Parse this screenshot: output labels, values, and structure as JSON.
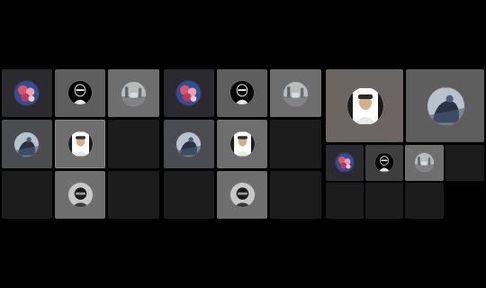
{
  "app": {
    "screen": "avatar-gallery"
  },
  "avatars": {
    "flowers": {
      "icon": "flower-bouquet-photo",
      "colors": [
        "#3a5aa8",
        "#e0546a",
        "#f0a0b0"
      ]
    },
    "mask": {
      "icon": "masked-figure-photo",
      "colors": [
        "#000000",
        "#e8e8e8"
      ]
    },
    "street": {
      "icon": "street-scene-photo",
      "colors": [
        "#b8bcbd",
        "#7f8486"
      ]
    },
    "horse": {
      "icon": "horse-rider-photo",
      "colors": [
        "#4a5d78",
        "#2a3344",
        "#b8c2cc"
      ]
    },
    "man": {
      "icon": "man-portrait-photo",
      "colors": [
        "#ffffff",
        "#2a2a2a",
        "#d4b08a"
      ]
    },
    "helmet": {
      "icon": "helmet-figure-photo",
      "colors": [
        "#1a1a1a",
        "#c8c8c8"
      ]
    }
  },
  "layouts": [
    {
      "id": "layout-1"
    },
    {
      "id": "layout-2"
    },
    {
      "id": "layout-3"
    }
  ]
}
